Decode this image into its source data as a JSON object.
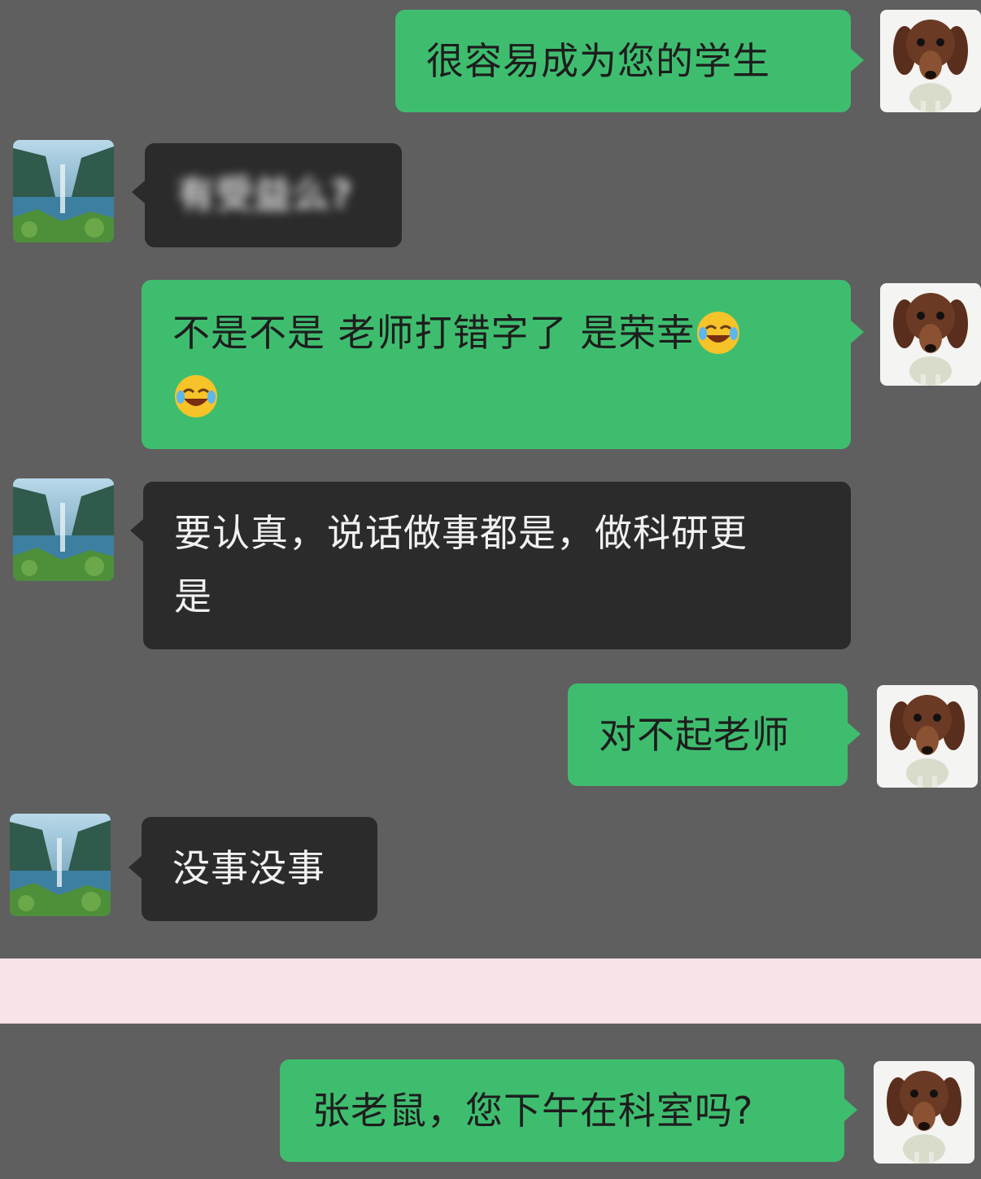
{
  "messages": [
    {
      "side": "out",
      "text": "很容易成为您的学生"
    },
    {
      "side": "in",
      "text": "有受益么?"
    },
    {
      "side": "out",
      "text_line1": "不是不是 老师打错字了 是荣幸",
      "emoji": "laughing-crying-emoji"
    },
    {
      "side": "in",
      "text_line1": "要认真，说话做事都是，做科研更",
      "text_line2": "是"
    },
    {
      "side": "out",
      "text": "对不起老师"
    },
    {
      "side": "in",
      "text": "没事没事"
    },
    {
      "side": "out",
      "text": "张老鼠，您下午在科室吗?"
    }
  ],
  "colors": {
    "background": "#5f5f5f",
    "outgoing_bubble": "#3fbd6f",
    "incoming_bubble": "#2b2b2b",
    "divider": "#f8e3e7"
  },
  "avatars": {
    "me": "dachshund-puppy-avatar",
    "teacher": "mountain-lake-avatar"
  }
}
